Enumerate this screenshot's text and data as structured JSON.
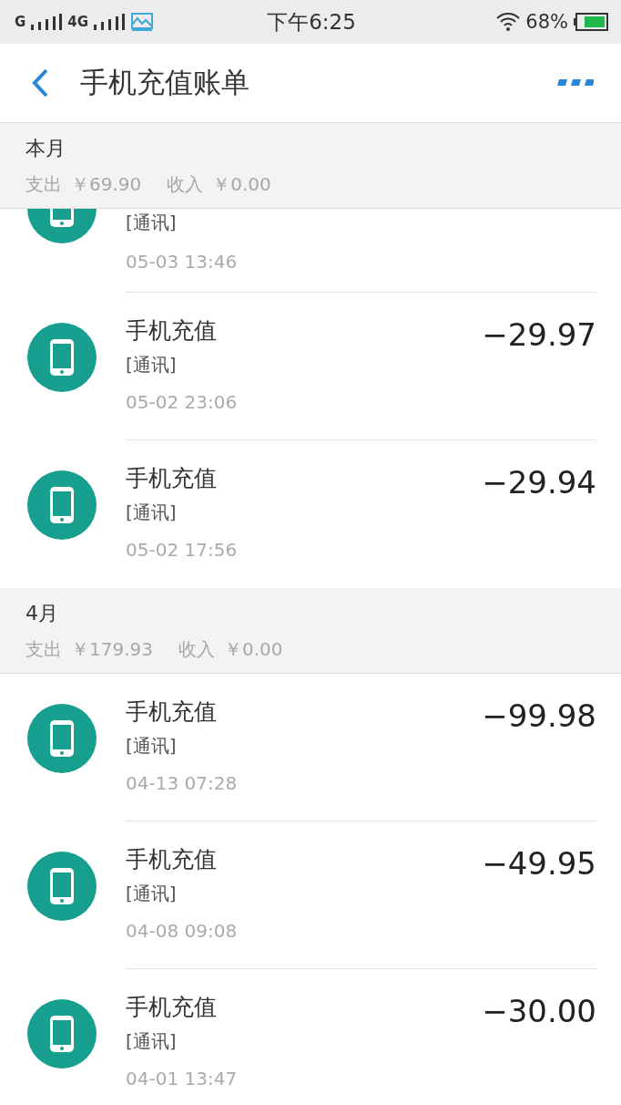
{
  "status_bar": {
    "carrier_1": "G",
    "carrier_2": "4G",
    "time": "下午6:25",
    "battery": "68%"
  },
  "header": {
    "title": "手机充值账单"
  },
  "sections": [
    {
      "title": "本月",
      "expense_label": "支出",
      "expense": "￥69.90",
      "income_label": "收入",
      "income": "￥0.00",
      "rows": [
        {
          "kind": "partial",
          "category": "[通讯]",
          "date": "05-03  13:46"
        },
        {
          "kind": "full",
          "title": "手机充值",
          "category": "[通讯]",
          "date": "05-02  23:06",
          "amount": "−29.97"
        },
        {
          "kind": "full",
          "title": "手机充值",
          "category": "[通讯]",
          "date": "05-02  17:56",
          "amount": "−29.94"
        }
      ]
    },
    {
      "title": "4月",
      "expense_label": "支出",
      "expense": "￥179.93",
      "income_label": "收入",
      "income": "￥0.00",
      "rows": [
        {
          "kind": "full",
          "title": "手机充值",
          "category": "[通讯]",
          "date": "04-13  07:28",
          "amount": "−99.98"
        },
        {
          "kind": "full",
          "title": "手机充值",
          "category": "[通讯]",
          "date": "04-08  09:08",
          "amount": "−49.95"
        },
        {
          "kind": "full",
          "title": "手机充值",
          "category": "[通讯]",
          "date": "04-01  13:47",
          "amount": "−30.00"
        }
      ]
    }
  ]
}
